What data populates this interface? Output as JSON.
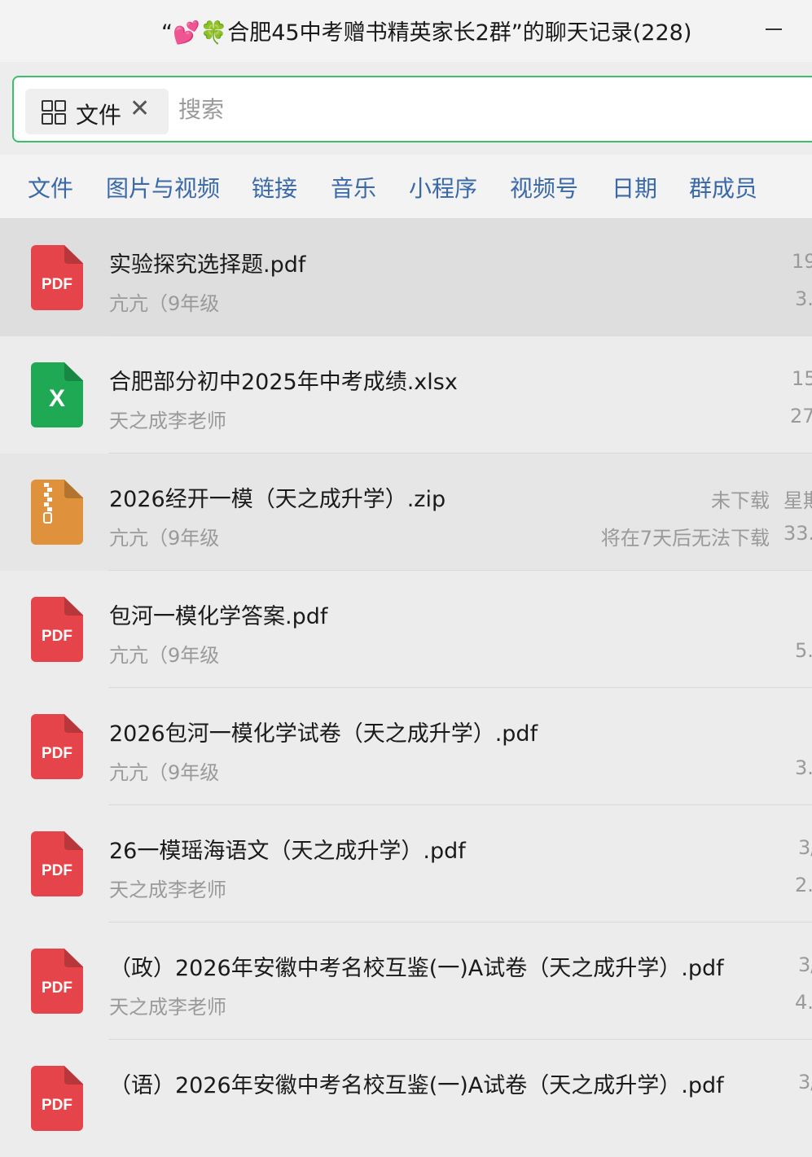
{
  "window": {
    "title_quote_open": "“",
    "title_hearts": "💕",
    "title_clover": "🍀",
    "title_text": "合肥45中考赠书精英家长2群”的聊天记录(228)",
    "minimize_icon": "minimize-icon"
  },
  "search": {
    "filter_chip_label": "文件",
    "filter_chip_close": "✕",
    "placeholder": "搜索"
  },
  "tabs": [
    "文件",
    "图片与视频",
    "链接",
    "音乐",
    "小程序",
    "视频号",
    "日期",
    "群成员"
  ],
  "files": [
    {
      "type": "pdf",
      "icon_label": "PDF",
      "name": "实验探究选择题.pdf",
      "sender": "亢亢（9年级",
      "meta1": "19",
      "meta2": "3."
    },
    {
      "type": "xlsx",
      "icon_label": "X",
      "name": "合肥部分初中2025年中考成绩.xlsx",
      "sender": "天之成李老师",
      "meta1": "15",
      "meta2": "27"
    },
    {
      "type": "zip",
      "icon_label": "",
      "name": "2026经开一模（天之成升学）.zip",
      "sender": "亢亢（9年级",
      "status1": "未下载",
      "status2": "将在7天后无法下载",
      "meta1": "星期",
      "meta2": "33."
    },
    {
      "type": "pdf",
      "icon_label": "PDF",
      "name": "包河一模化学答案.pdf",
      "sender": "亢亢（9年级",
      "meta1": "",
      "meta2": "5."
    },
    {
      "type": "pdf",
      "icon_label": "PDF",
      "name": "2026包河一模化学试卷（天之成升学）.pdf",
      "sender": "亢亢（9年级",
      "meta1": "",
      "meta2": "3."
    },
    {
      "type": "pdf",
      "icon_label": "PDF",
      "name": "26一模瑶海语文（天之成升学）.pdf",
      "sender": "天之成李老师",
      "meta1": "3/",
      "meta2": "2."
    },
    {
      "type": "pdf",
      "icon_label": "PDF",
      "name": "（政）2026年安徽中考名校互鉴(一)A试卷（天之成升学）.pdf",
      "sender": "天之成李老师",
      "meta1": "3/",
      "meta2": "4."
    },
    {
      "type": "pdf",
      "icon_label": "PDF",
      "name": "（语）2026年安徽中考名校互鉴(一)A试卷（天之成升学）.pdf",
      "sender": "",
      "meta1": "3/",
      "meta2": ""
    }
  ],
  "colors": {
    "accent_green": "#3bbf6c",
    "tab_blue": "#3a69a9",
    "pdf_red": "#e5454a",
    "xlsx_green": "#1fa955",
    "zip_orange": "#e0913b"
  }
}
